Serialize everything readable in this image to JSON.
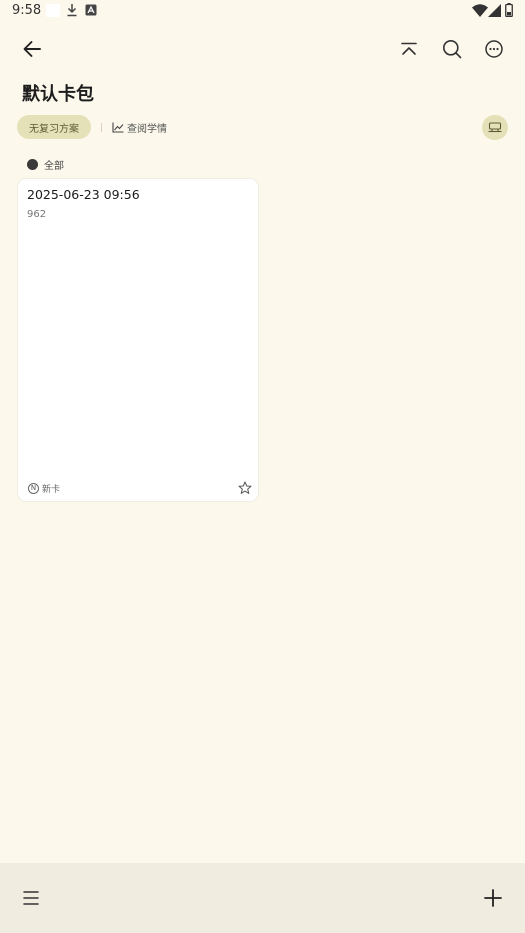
{
  "status_bar": {
    "time": "9:58",
    "icons": [
      "white-square-icon",
      "download-icon",
      "app-a-icon",
      "wifi-icon",
      "signal-icon",
      "battery-icon"
    ]
  },
  "toolbar": {
    "icons": [
      "back-arrow-icon",
      "collapse-up-icon",
      "search-icon",
      "more-dots-icon"
    ]
  },
  "page": {
    "title": "默认卡包"
  },
  "chips": {
    "plan_label": "无复习方案",
    "stats_label": "查阅学情"
  },
  "filter": {
    "label": "全部"
  },
  "cards": [
    {
      "title": "2025-06-23 09:56",
      "content": "962",
      "badge": "N",
      "type_label": "新卡"
    }
  ],
  "colors": {
    "background": "#FCF8EC",
    "chip": "#E4E1B8",
    "card": "#FFFFFF",
    "bottom_bar": "#F0ECE0"
  }
}
